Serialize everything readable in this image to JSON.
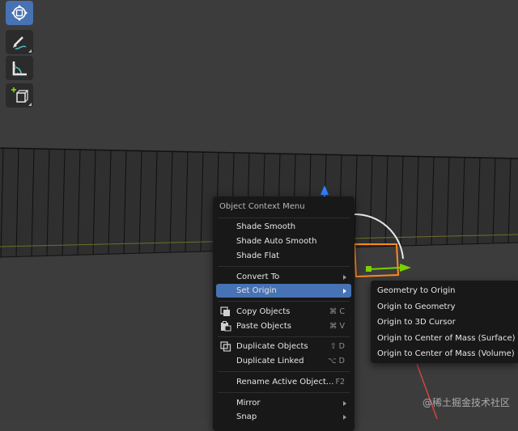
{
  "toolbar": {
    "tools": [
      {
        "name": "transform-tool",
        "icon": "transform-icon",
        "active": true
      },
      {
        "name": "annotate-tool",
        "icon": "annotate-pencil-icon",
        "active": false
      },
      {
        "name": "measure-tool",
        "icon": "measure-ruler-icon",
        "active": false
      },
      {
        "name": "add-cube-tool",
        "icon": "add-cube-icon",
        "active": false
      }
    ]
  },
  "context_menu": {
    "title": "Object Context Menu",
    "items": [
      {
        "label": "Shade Smooth",
        "shortcut": "",
        "submenu": false
      },
      {
        "label": "Shade Auto Smooth",
        "shortcut": "",
        "submenu": false
      },
      {
        "label": "Shade Flat",
        "shortcut": "",
        "submenu": false
      },
      {
        "label": "Convert To",
        "shortcut": "",
        "submenu": true
      },
      {
        "label": "Set Origin",
        "shortcut": "",
        "submenu": true,
        "highlighted": true
      },
      {
        "label": "Copy Objects",
        "shortcut": "⌘ C",
        "icon": "copy-icon"
      },
      {
        "label": "Paste Objects",
        "shortcut": "⌘ V",
        "icon": "paste-icon"
      },
      {
        "label": "Duplicate Objects",
        "shortcut": "⇧ D",
        "icon": "duplicate-icon"
      },
      {
        "label": "Duplicate Linked",
        "shortcut": "⌥ D"
      },
      {
        "label": "Rename Active Object...",
        "shortcut": "F2"
      },
      {
        "label": "Mirror",
        "shortcut": "",
        "submenu": true
      },
      {
        "label": "Snap",
        "shortcut": "",
        "submenu": true
      }
    ]
  },
  "set_origin_submenu": {
    "items": [
      "Geometry to Origin",
      "Origin to Geometry",
      "Origin to 3D Cursor",
      "Origin to Center of Mass (Surface)",
      "Origin to Center of Mass (Volume)"
    ]
  },
  "watermark": "@稀土掘金技术社区",
  "colors": {
    "viewport_bg": "#3c3c3c",
    "menu_bg": "#181818",
    "highlight": "#4772b3",
    "selection_orange": "#ff8a1e",
    "axis_x": "#d14545",
    "axis_y": "#7ad100",
    "axis_z": "#2f7fff"
  }
}
